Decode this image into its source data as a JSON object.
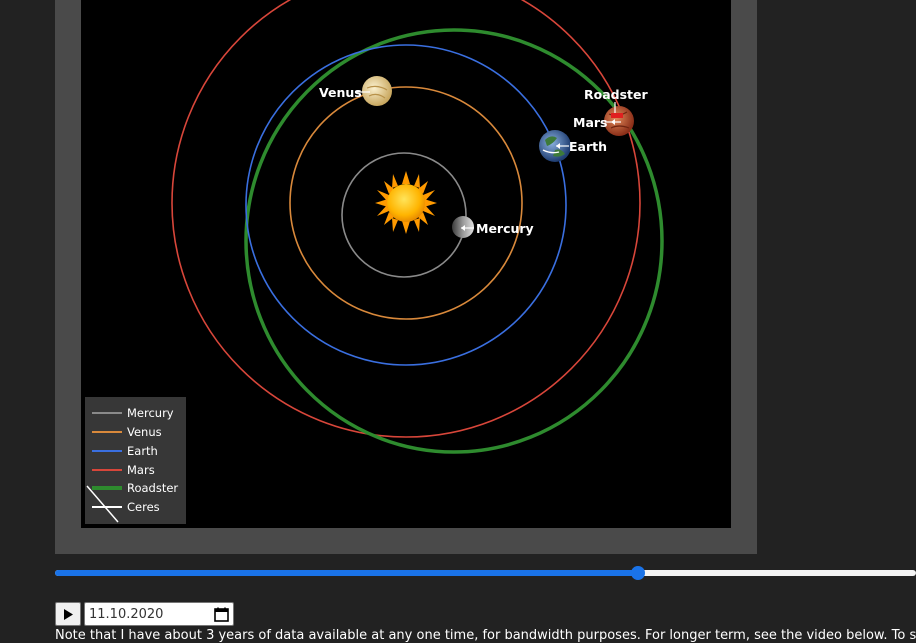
{
  "colors": {
    "page_bg": "#222222",
    "frame_bg": "#4a4a4a",
    "plot_bg": "#000000",
    "mercury": "#8a8a8a",
    "venus": "#d9893b",
    "earth": "#3a6fe0",
    "mars": "#d8463a",
    "roadster": "#2e8b2e",
    "ceres": "#ffffff",
    "slider": "#1a73e8"
  },
  "planets": {
    "venus": "Venus",
    "mercury": "Mercury",
    "earth": "Earth",
    "mars": "Mars",
    "roadster": "Roadster"
  },
  "legend": {
    "items": [
      {
        "name": "Mercury",
        "color": "#8a8a8a"
      },
      {
        "name": "Venus",
        "color": "#d9893b"
      },
      {
        "name": "Earth",
        "color": "#3a6fe0"
      },
      {
        "name": "Mars",
        "color": "#d8463a"
      },
      {
        "name": "Roadster",
        "color": "#2e8b2e"
      },
      {
        "name": "Ceres",
        "color": "#ffffff"
      }
    ]
  },
  "slider": {
    "progress": 0.677
  },
  "controls": {
    "play_icon": "play-icon",
    "date_value": "11.10.2020",
    "calendar_icon": "calendar-icon"
  },
  "note": "Note that I have about 3 years of data available at any one time, for bandwidth purposes. For longer term, see the video below. To s"
}
